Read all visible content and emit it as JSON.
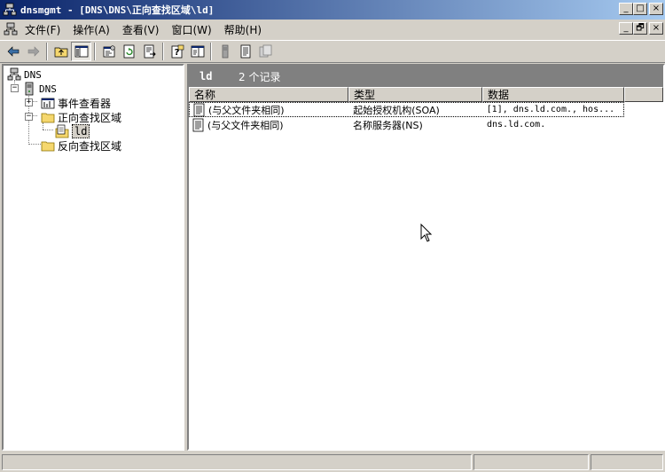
{
  "window": {
    "title": "dnsmgmt - [DNS\\DNS\\正向查找区域\\ld]",
    "caption_buttons": [
      "_",
      "□",
      "×"
    ]
  },
  "menubar": {
    "items": [
      "文件(F)",
      "操作(A)",
      "查看(V)",
      "窗口(W)",
      "帮助(H)"
    ],
    "mdi_buttons": [
      "_",
      "🗗",
      "×"
    ]
  },
  "toolbar": {
    "buttons": [
      "back-arrow-icon",
      "forward-arrow-icon",
      "up-folder-icon",
      "show-tree-icon",
      "properties-icon",
      "refresh-icon",
      "export-list-icon",
      "help-icon",
      "action-pane-icon",
      "server-icon",
      "record-icon",
      "copy-icon"
    ]
  },
  "tree": {
    "root": "DNS",
    "server": "DNS",
    "event_viewer": "事件查看器",
    "forward_zones": "正向查找区域",
    "zone_ld": "ld",
    "reverse_zones": "反向查找区域"
  },
  "rightpane": {
    "zone_name": "ld",
    "record_count": "2 个记录",
    "columns": [
      "名称",
      "类型",
      "数据"
    ],
    "rows": [
      {
        "name": "(与父文件夹相同)",
        "type": "起始授权机构(SOA)",
        "data": "[1], dns.ld.com., hos..."
      },
      {
        "name": "(与父文件夹相同)",
        "type": "名称服务器(NS)",
        "data": "dns.ld.com."
      }
    ]
  },
  "colors": {
    "titlebar_start": "#0a246a",
    "titlebar_end": "#a6caf0",
    "chrome": "#d4d0c8",
    "pane_header": "#808080"
  }
}
